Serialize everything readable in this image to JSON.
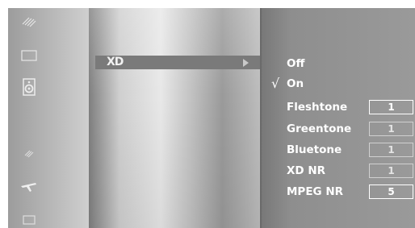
{
  "menu": {
    "selected_item": "XD"
  },
  "submenu": {
    "options": [
      {
        "label": "Off",
        "checked": false
      },
      {
        "label": "On",
        "checked": true
      },
      {
        "label": "Fleshtone",
        "value": "1"
      },
      {
        "label": "Greentone",
        "value": "1"
      },
      {
        "label": "Bluetone",
        "value": "1"
      },
      {
        "label": "XD NR",
        "value": "1"
      },
      {
        "label": "MPEG NR",
        "value": "5"
      }
    ],
    "check_mark": "√"
  },
  "icons": [
    "picture-icon",
    "screen-icon",
    "speaker-icon",
    "option-icon",
    "airplane-icon",
    "lock-icon"
  ]
}
